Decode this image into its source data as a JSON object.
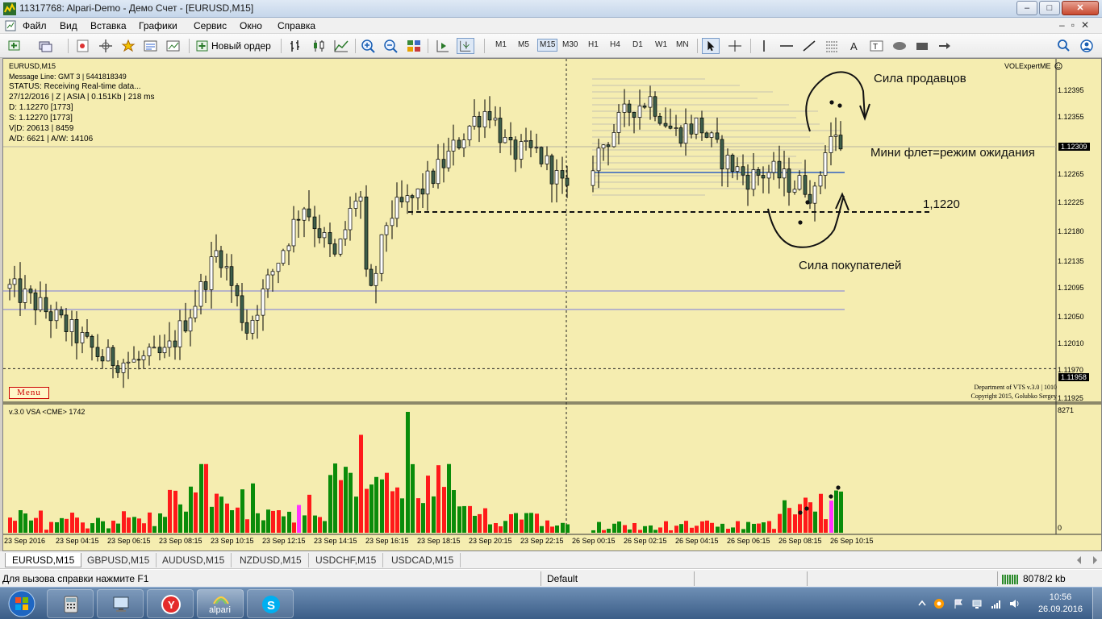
{
  "window": {
    "title": "11317768: Alpari-Demo - Демо Счет - [EURUSD,M15]"
  },
  "menu": [
    "Файл",
    "Вид",
    "Вставка",
    "Графики",
    "Сервис",
    "Окно",
    "Справка"
  ],
  "toolbar": {
    "new_order": "Новый ордер",
    "timeframes": [
      "M1",
      "M5",
      "M15",
      "M30",
      "H1",
      "H4",
      "D1",
      "W1",
      "MN"
    ],
    "active_timeframe": "M15"
  },
  "chart": {
    "header": "EURUSD,M15",
    "expert": "VOLExpertME",
    "info_lines": [
      "Message Line: GMT 3 | 5441818349",
      "STATUS:  Receiving Real-time data...",
      "27/12/2016 | Z | ASIA | 0.151Kb | 218 ms",
      "D: 1.12270  [1773]",
      "S: 1.12270  [1773]",
      "V|D: 20613 | 8459",
      "A/D: 6621 | A/W: 14106"
    ],
    "menu_label": "Menu",
    "copyright_1": "Department of VTS  v.3.0 | 1010",
    "copyright_2": "Copyright 2015, Golubko Sergey",
    "indicator_label": "v.3.0 VSA <CME> 1742",
    "volume_max_label": "8271",
    "volume_zero_label": "0",
    "annotations": {
      "sellers": "Сила продавцов",
      "flat": "Мини флет=режим ожидания",
      "level": "1,1220",
      "buyers": "Сила покупателей"
    },
    "price_labels": [
      "1.12395",
      "1.12355",
      "1.12265",
      "1.12225",
      "1.12180",
      "1.12135",
      "1.12095",
      "1.12050",
      "1.12010",
      "1.11970",
      "1.11925"
    ],
    "current_price": "1.12309",
    "bid_price": "1.11958",
    "time_labels": [
      "23 Sep 2016",
      "23 Sep 04:15",
      "23 Sep 06:15",
      "23 Sep 08:15",
      "23 Sep 10:15",
      "23 Sep 12:15",
      "23 Sep 14:15",
      "23 Sep 16:15",
      "23 Sep 18:15",
      "23 Sep 20:15",
      "23 Sep 22:15",
      "26 Sep 00:15",
      "26 Sep 02:15",
      "26 Sep 04:15",
      "26 Sep 06:15",
      "26 Sep 08:15",
      "26 Sep 10:15"
    ],
    "colors": {
      "background": "#f5edb0",
      "bull": "#ffffff",
      "bear": "#3d5e4a",
      "volume_up": "#0a8c0a",
      "volume_down": "#ff1a1a",
      "volume_climax": "#ff33ff",
      "level_line": "#3060c0"
    }
  },
  "tabs": [
    "EURUSD,M15",
    "GBPUSD,M15",
    "AUDUSD,M15",
    "NZDUSD,M15",
    "USDCHF,M15",
    "USDCAD,M15"
  ],
  "active_tab": "EURUSD,M15",
  "status": {
    "help": "Для вызова справки нажмите F1",
    "profile": "Default",
    "connection": "8078/2 kb"
  },
  "taskbar": {
    "alpari_label": "alpari",
    "clock_time": "10:56",
    "clock_date": "26.09.2016"
  }
}
